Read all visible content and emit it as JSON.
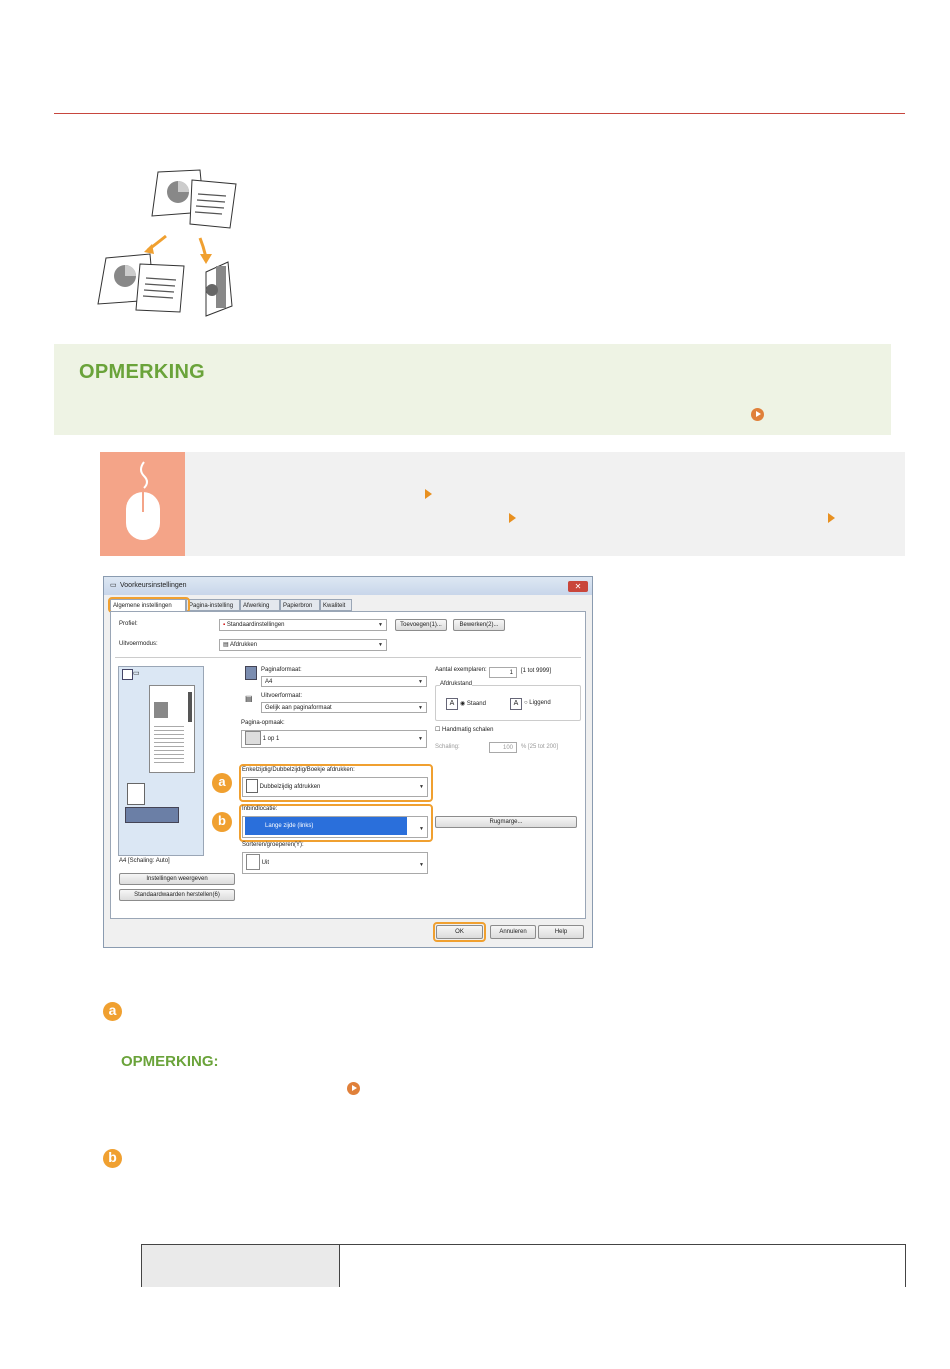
{
  "page": {
    "note_title": "OPMERKING",
    "bullet_a": "a",
    "bullet_b": "b",
    "sub_note_title": "OPMERKING:"
  },
  "dialog": {
    "title": "Voorkeursinstellingen",
    "tabs": [
      "Algemene instellingen",
      "Pagina-instelling",
      "Afwerking",
      "Papierbron",
      "Kwaliteit"
    ],
    "profile_label": "Profiel:",
    "profile_value": "Standaardinstellingen",
    "add_button": "Toevoegen(1)...",
    "edit_button": "Bewerken(2)...",
    "output_mode_label": "Uitvoermodus:",
    "output_mode_value": "Afdrukken",
    "page_size_label": "Paginaformaat:",
    "page_size_value": "A4",
    "output_size_label": "Uitvoerformaat:",
    "output_size_value": "Gelijk aan paginaformaat",
    "page_layout_label": "Pagina-opmaak:",
    "page_layout_value": "1 op 1",
    "copies_label": "Aantal exemplaren:",
    "copies_value": "1",
    "copies_range": "[1 tot 9999]",
    "orientation_label": "Afdrukstand",
    "orientation_portrait": "Staand",
    "orientation_landscape": "Liggend",
    "manual_scaling_label": "Handmatig schalen",
    "scaling_label": "Schaling:",
    "scaling_value": "100",
    "scaling_range": "% [25 tot 200]",
    "duplex_label": "Enkelzijdig/Dubbelzijdig/Boekje afdrukken:",
    "duplex_value": "Dubbelzijdig afdrukken",
    "binding_label": "Inbindlocatie:",
    "binding_value": "Lange zijde (links)",
    "gutter_button": "Rugmarge...",
    "collate_label": "Sorteren/groeperen(Y):",
    "collate_value": "Uit",
    "preview_status": "A4 [Schaling: Auto]",
    "view_settings_button": "Instellingen weergeven",
    "restore_defaults_button": "Standaardwaarden herstellen(6)",
    "ok_button": "OK",
    "cancel_button": "Annuleren",
    "help_button": "Help",
    "badge_a": "a",
    "badge_b": "b"
  },
  "colors": {
    "accent_red": "#c7463e",
    "note_green": "#6aa33a",
    "highlight_orange": "#f0a030",
    "mouse_panel": "#f4a488"
  }
}
